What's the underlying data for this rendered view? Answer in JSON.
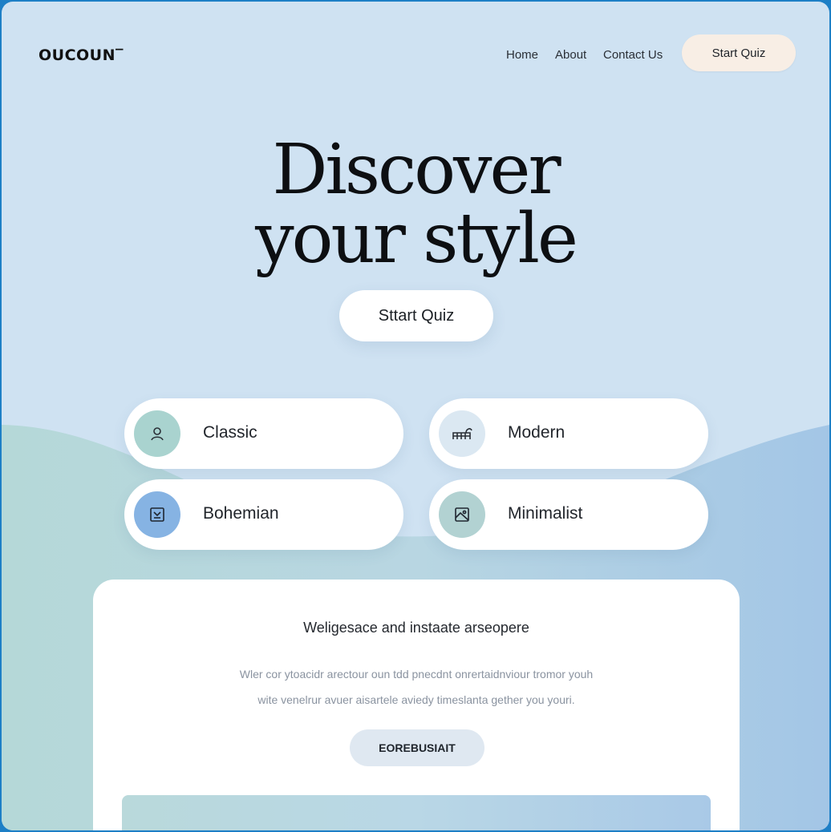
{
  "header": {
    "logo": "OUCOUN‾",
    "nav": {
      "home": "Home",
      "about": "About",
      "contact": "Contact Us"
    },
    "cta": "Start Quiz"
  },
  "hero": {
    "title_line1": "Discover",
    "title_line2": "your style",
    "cta": "Sttart Quiz"
  },
  "styles": [
    {
      "label": "Classic",
      "icon": "person-icon",
      "color": "#a9d3cf"
    },
    {
      "label": "Modern",
      "icon": "furniture-icon",
      "color": "#dbe8f2"
    },
    {
      "label": "Bohemian",
      "icon": "frame-icon",
      "color": "#86b3e3"
    },
    {
      "label": "Minimalist",
      "icon": "image-icon",
      "color": "#b2d2d2"
    }
  ],
  "panel": {
    "title": "Weligesace and instaate arseopere",
    "line1": "Wler cor ytoacidr arectour oun tdd pnecdnt onrertaidnviour tromor youh",
    "line2": "wite venelrur avuer aisartele aviedy timeslanta gether you youri.",
    "button": "EOREBUSIAIT"
  },
  "colors": {
    "background": "#cfe2f2",
    "hill_left": "#b5d8d8",
    "hill_right": "#a3c6e6",
    "header_cta": "#f8eee5",
    "border": "#1d7fc6"
  }
}
